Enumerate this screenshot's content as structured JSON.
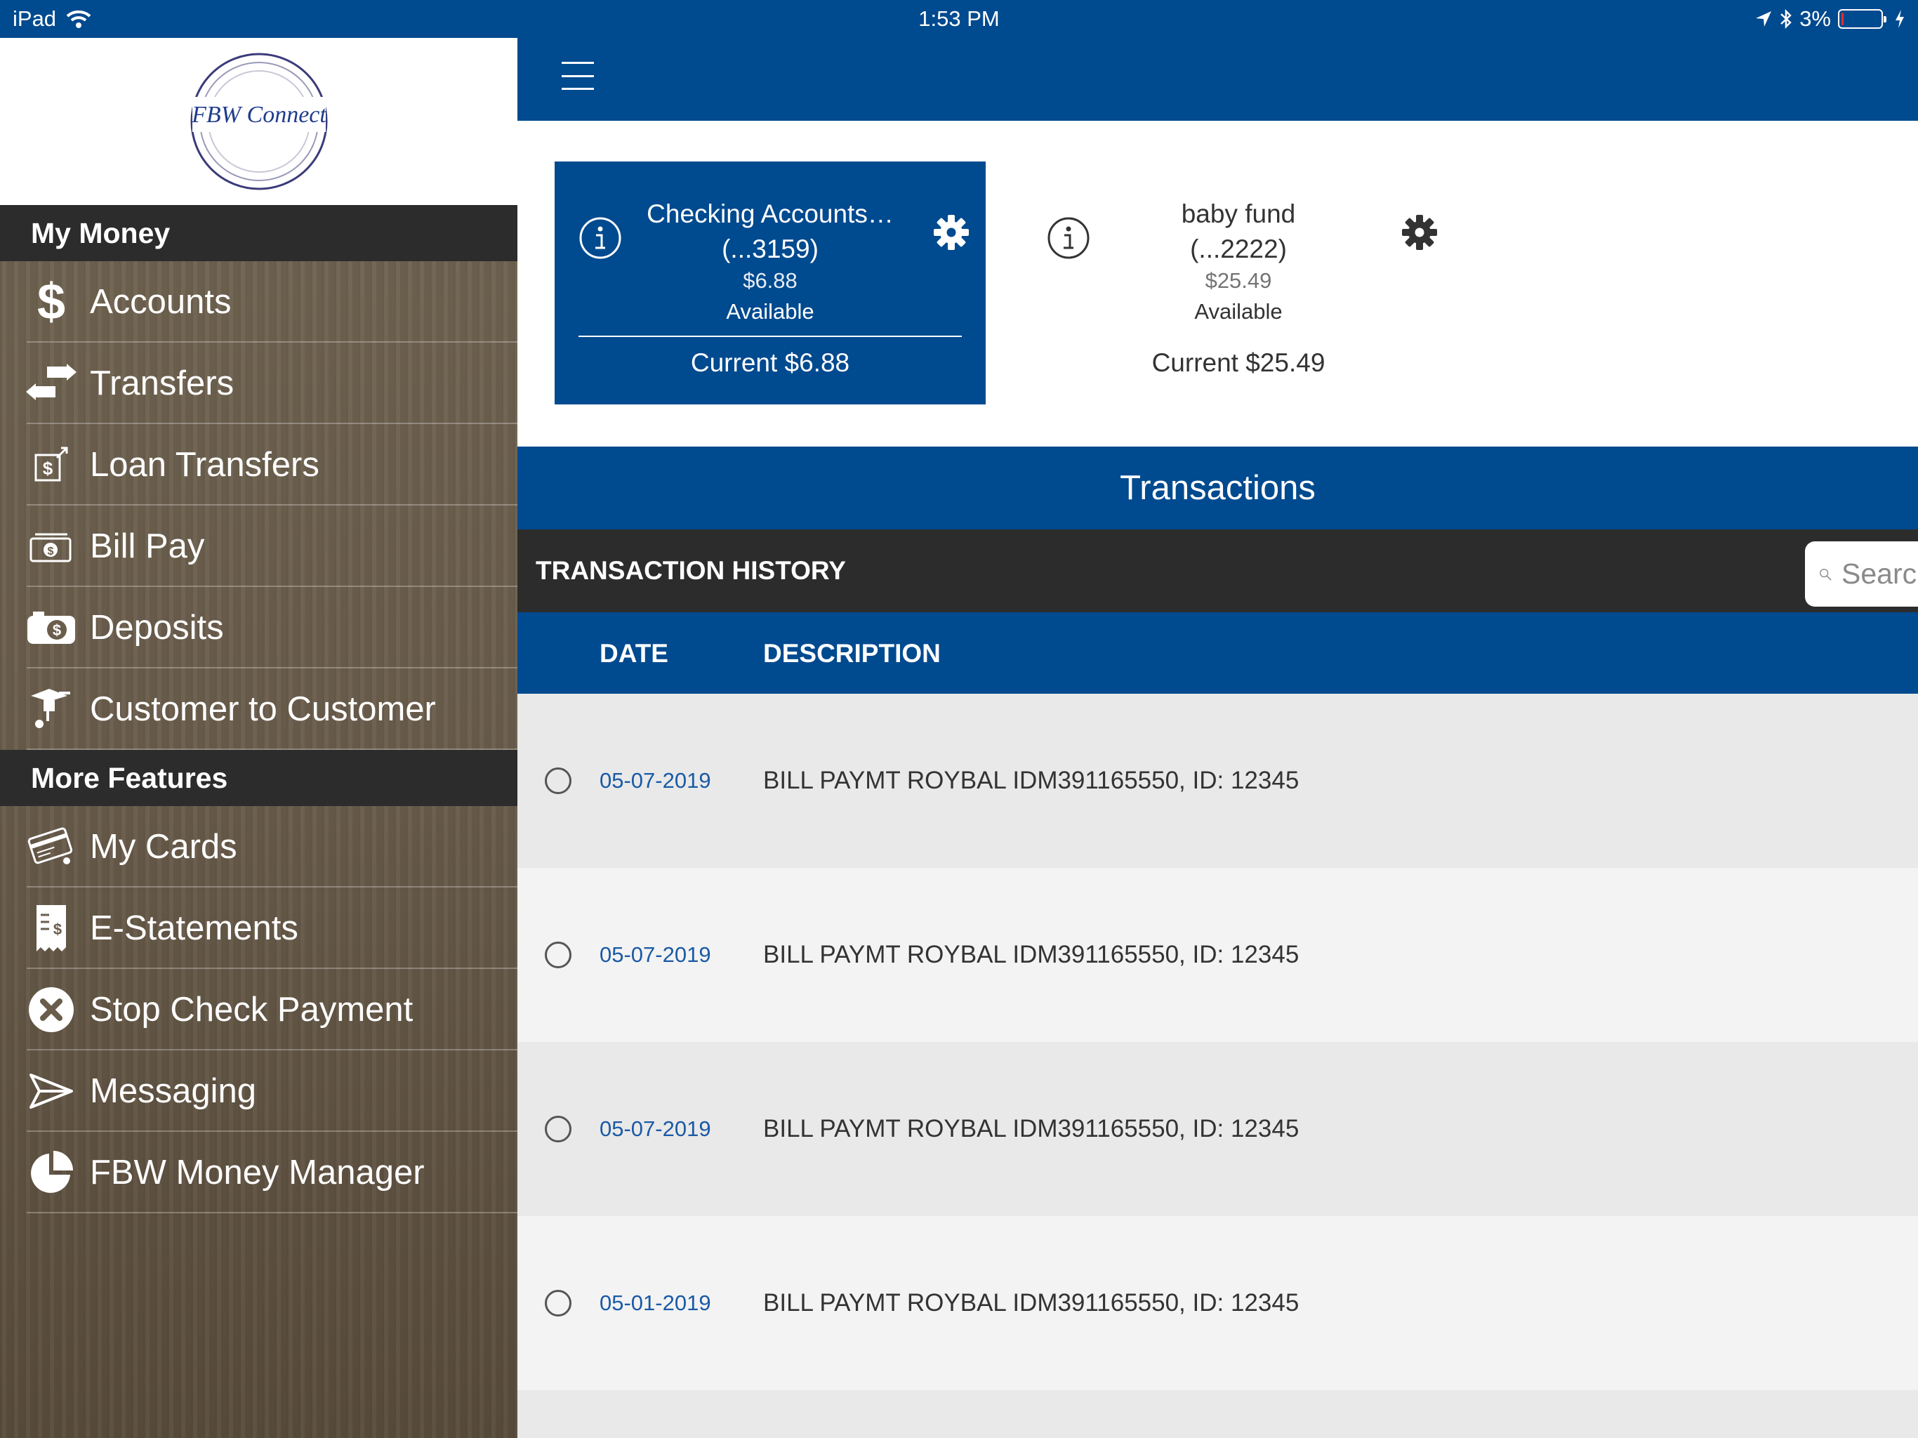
{
  "status_bar": {
    "device": "iPad",
    "time": "1:53 PM",
    "battery_percent": "3%",
    "battery_level": 0.03,
    "icons": [
      "wifi-icon",
      "location-arrow-icon",
      "bluetooth-icon",
      "battery-icon",
      "charging-bolt-icon"
    ]
  },
  "logo": {
    "text": "FBW Connect"
  },
  "sidebar": {
    "my_money_header": "My Money",
    "my_money_items": [
      {
        "label": "Accounts",
        "icon": "dollar-icon"
      },
      {
        "label": "Transfers",
        "icon": "transfer-arrows-icon"
      },
      {
        "label": "Loan Transfers",
        "icon": "loan-transfer-icon"
      },
      {
        "label": "Bill Pay",
        "icon": "bill-pay-icon"
      },
      {
        "label": "Deposits",
        "icon": "camera-deposit-icon"
      },
      {
        "label": "Customer to Customer",
        "icon": "customer-transfer-icon"
      }
    ],
    "more_features_header": "More Features",
    "more_features_items": [
      {
        "label": "My Cards",
        "icon": "cards-icon"
      },
      {
        "label": "E-Statements",
        "icon": "receipt-icon"
      },
      {
        "label": "Stop Check Payment",
        "icon": "stop-x-icon"
      },
      {
        "label": "Messaging",
        "icon": "paper-plane-icon"
      },
      {
        "label": "FBW Money Manager",
        "icon": "pie-chart-icon"
      }
    ]
  },
  "accounts": [
    {
      "name": "Checking Accounts…",
      "number": "(...3159)",
      "available_amount": "$6.88",
      "available_label": "Available",
      "current": "Current $6.88",
      "selected": true
    },
    {
      "name": "baby fund",
      "number": "(...2222)",
      "available_amount": "$25.49",
      "available_label": "Available",
      "current": "Current $25.49",
      "selected": false
    }
  ],
  "transactions": {
    "title": "Transactions",
    "history_label": "TRANSACTION HISTORY",
    "search_placeholder": "Search",
    "columns": {
      "date": "DATE",
      "description": "DESCRIPTION"
    },
    "rows": [
      {
        "date": "05-07-2019",
        "description": "BILL PAYMT ROYBAL IDM391165550, ID: 12345"
      },
      {
        "date": "05-07-2019",
        "description": "BILL PAYMT ROYBAL IDM391165550, ID: 12345"
      },
      {
        "date": "05-07-2019",
        "description": "BILL PAYMT ROYBAL IDM391165550, ID: 12345"
      },
      {
        "date": "05-01-2019",
        "description": "BILL PAYMT ROYBAL IDM391165550, ID: 12345"
      }
    ]
  },
  "colors": {
    "brand_blue": "#004a8f",
    "dark_header": "#2c2c2c",
    "sidebar_wood": "#6a5d4c",
    "date_text": "#1a5aa6"
  }
}
